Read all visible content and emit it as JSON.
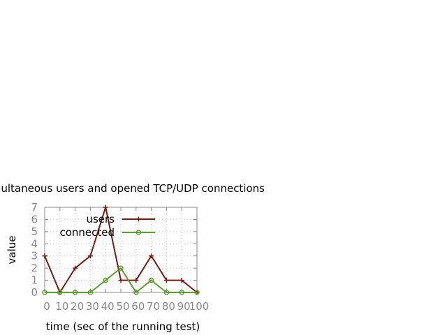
{
  "chart_data": {
    "type": "line",
    "title": "Simultaneous users and opened TCP/UDP connections",
    "xlabel": "time (sec of the running test)",
    "ylabel": "value",
    "x": [
      0,
      10,
      20,
      30,
      40,
      50,
      60,
      70,
      80,
      90,
      100
    ],
    "xticks": [
      "0",
      "10",
      "20",
      "30",
      "40",
      "50",
      "60",
      "70",
      "80",
      "90",
      "100"
    ],
    "yticks": [
      "0",
      "1",
      "2",
      "3",
      "4",
      "5",
      "6",
      "7"
    ],
    "xlim": [
      0,
      100
    ],
    "ylim": [
      0,
      7
    ],
    "grid": true,
    "legend_position": "top-right",
    "series": [
      {
        "name": "users",
        "color": "#7a1a0f",
        "marker": "plus",
        "values": [
          3,
          0,
          2,
          3,
          7,
          1,
          1,
          3,
          1,
          1,
          0
        ]
      },
      {
        "name": "connected",
        "color": "#5d9e2f",
        "marker": "circle",
        "values": [
          0,
          0,
          0,
          0,
          1,
          2,
          0,
          1,
          0,
          0,
          0
        ]
      }
    ]
  }
}
